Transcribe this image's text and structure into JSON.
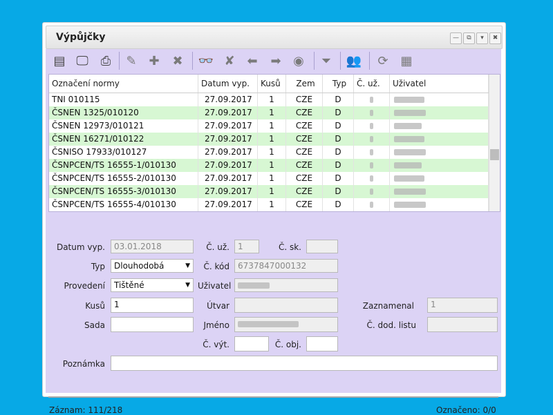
{
  "window": {
    "title": "Výpůjčky"
  },
  "grid": {
    "headers": [
      "Označení normy",
      "Datum vyp.",
      "Kusů",
      "Zem",
      "Typ",
      "Č. už.",
      "Uživatel"
    ],
    "rows": [
      [
        "TNI 010115",
        "27.09.2017",
        "1",
        "CZE",
        "D"
      ],
      [
        "ČSNEN 1325/010120",
        "27.09.2017",
        "1",
        "CZE",
        "D"
      ],
      [
        "ČSNEN 12973/010121",
        "27.09.2017",
        "1",
        "CZE",
        "D"
      ],
      [
        "ČSNEN 16271/010122",
        "27.09.2017",
        "1",
        "CZE",
        "D"
      ],
      [
        "ČSNISO 17933/010127",
        "27.09.2017",
        "1",
        "CZE",
        "D"
      ],
      [
        "ČSNPCEN/TS 16555-1/010130",
        "27.09.2017",
        "1",
        "CZE",
        "D"
      ],
      [
        "ČSNPCEN/TS 16555-2/010130",
        "27.09.2017",
        "1",
        "CZE",
        "D"
      ],
      [
        "ČSNPCEN/TS 16555-3/010130",
        "27.09.2017",
        "1",
        "CZE",
        "D"
      ],
      [
        "ČSNPCEN/TS 16555-4/010130",
        "27.09.2017",
        "1",
        "CZE",
        "D"
      ]
    ]
  },
  "form": {
    "datum_vyp_label": "Datum vyp.",
    "datum_vyp_value": "03.01.2018",
    "c_uz_label": "Č. už.",
    "c_uz_value": "1",
    "c_sk_label": "Č. sk.",
    "c_sk_value": "",
    "typ_label": "Typ",
    "typ_value": "Dlouhodobá",
    "c_kod_label": "Č. kód",
    "c_kod_value": "6737847000132",
    "provedeni_label": "Provedení",
    "provedeni_value": "Tištěné",
    "uzivatel_label": "Uživatel",
    "kusu_label": "Kusů",
    "kusu_value": "1",
    "utvar_label": "Útvar",
    "utvar_value": "",
    "zaznamenal_label": "Zaznamenal",
    "zaznamenal_value": "1",
    "sada_label": "Sada",
    "sada_value": "",
    "jmeno_label": "Jméno",
    "c_dod_listu_label": "Č. dod. listu",
    "c_dod_listu_value": "",
    "c_vyt_label": "Č. výt.",
    "c_vyt_value": "",
    "c_obj_label": "Č. obj.",
    "c_obj_value": "",
    "poznamka_label": "Poznámka",
    "poznamka_value": ""
  },
  "status": {
    "zaznam": "Záznam:  111/218",
    "oznaceno": "Označeno: 0/0"
  },
  "colors": {
    "background": "#07a9e6",
    "panel": "#dcd3f5",
    "row_alt": "#d7f7d3"
  }
}
